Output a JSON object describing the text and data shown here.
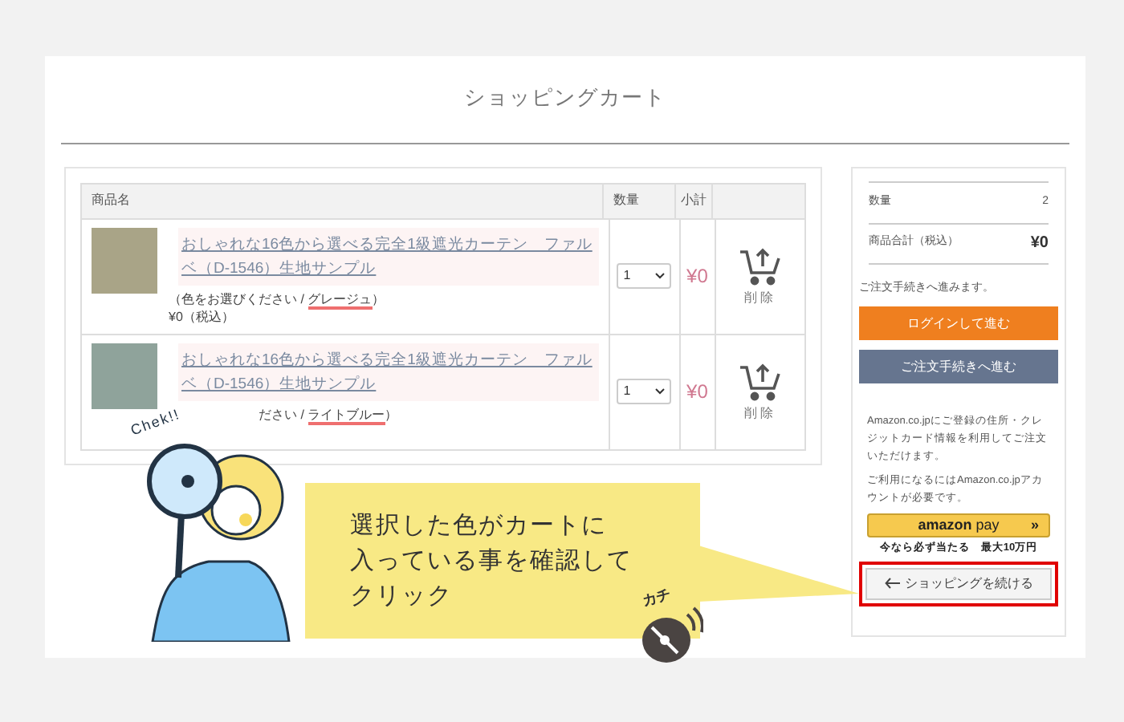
{
  "page_title": "ショッピングカート",
  "table": {
    "columns": [
      "商品名",
      "数量",
      "小計"
    ],
    "rows": [
      {
        "name": "おしゃれな16色から選べる完全1級遮光カーテン　ファルベ（D-1546）生地サンプル",
        "color": "#a9a487",
        "option_prefix": "（色をお選びください / ",
        "option_value": "グレージュ",
        "option_suffix": "）",
        "price_line": "¥0（税込）",
        "quantity": "1",
        "subtotal": "¥0",
        "delete_label": "削除"
      },
      {
        "name": "おしゃれな16色から選べる完全1級遮光カーテン　ファルベ（D-1546）生地サンプル",
        "color": "#8fa39b",
        "option_prefix": "ださい / ",
        "option_value": "ライトブルー",
        "option_suffix": "）",
        "quantity": "1",
        "subtotal": "¥0",
        "delete_label": "削除"
      }
    ]
  },
  "summary": {
    "rows": [
      {
        "label": "数量",
        "value": "2",
        "kind": "count"
      },
      {
        "label": "商品合計（税込）",
        "value": "¥0",
        "kind": "total"
      }
    ],
    "note": "ご注文手続きへ進みます。",
    "buttons": [
      {
        "label": "ログインして進む",
        "kind": "login"
      },
      {
        "label": "ご注文手続きへ進む",
        "kind": "checkout"
      }
    ],
    "amazon_text": [
      "Amazon.co.jpにご登録の住所・クレジットカード情報を利用してご注文いただけます。",
      "ご利用になるにはAmazon.co.jpアカウントが必要です。"
    ],
    "amazon_pay": {
      "logo_left": "amazon",
      "logo_right": "pay",
      "arrows": "»"
    },
    "promo": "今なら必ず当たる　最大10万円",
    "continue_button": {
      "label": "ショッピングを続ける",
      "highlighted": true
    }
  },
  "callout": {
    "lines": [
      "選択した色がカートに",
      "入っている事を確認して",
      "クリック"
    ],
    "check_label": "Chek!!",
    "click_sound": "カチ"
  }
}
